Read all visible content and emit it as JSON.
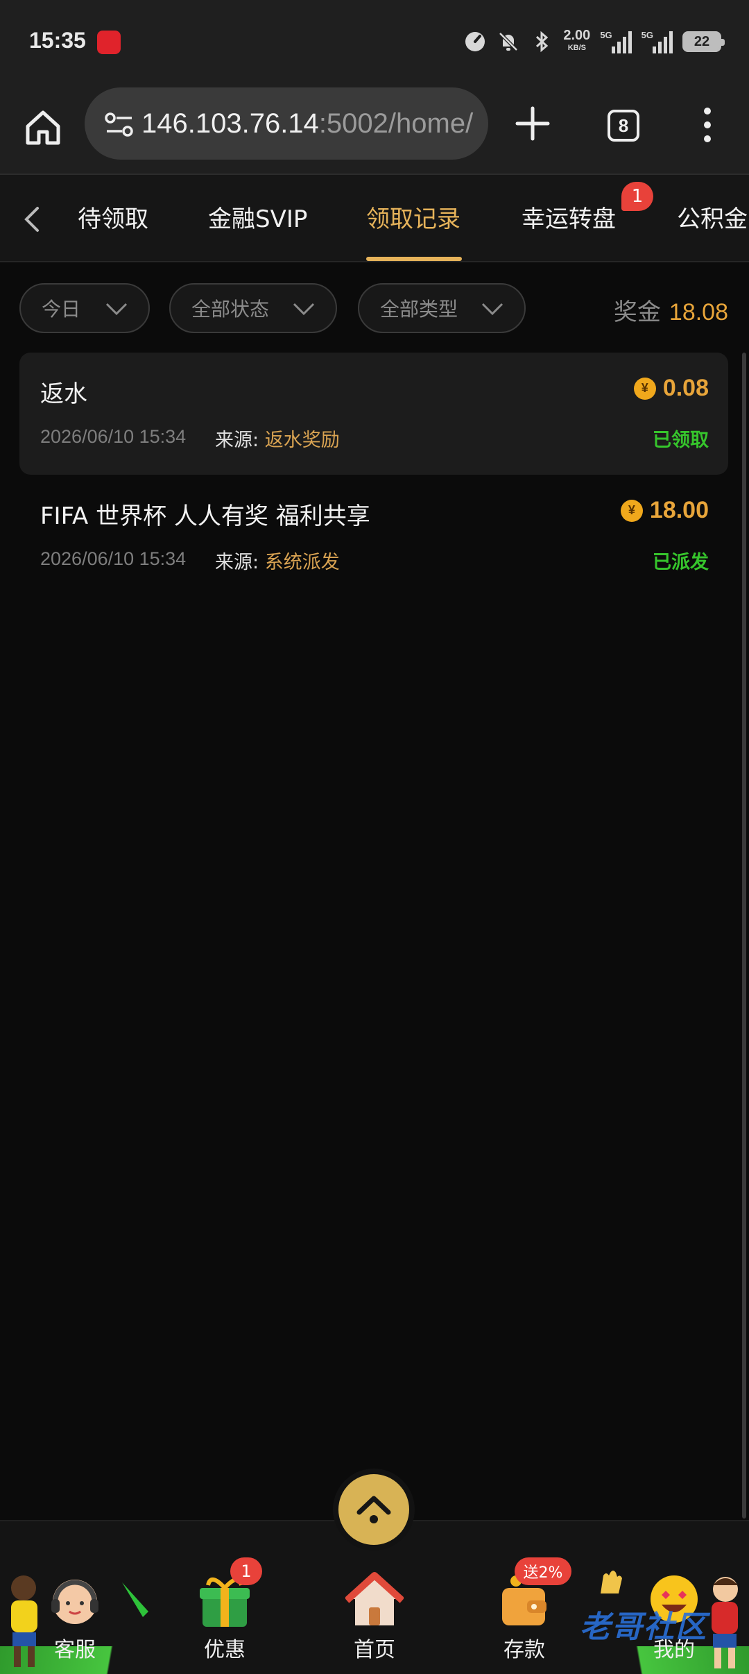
{
  "status_bar": {
    "time": "15:35",
    "speed_value": "2.00",
    "speed_unit": "KB/S",
    "net1": "5G",
    "net2": "5G",
    "battery": "22"
  },
  "browser": {
    "url_host": "146.103.76.14",
    "url_rest": ":5002/home/",
    "tab_count": "8"
  },
  "tabs": [
    {
      "label": "待领取"
    },
    {
      "label": "金融SVIP"
    },
    {
      "label": "领取记录"
    },
    {
      "label": "幸运转盘"
    },
    {
      "label": "公积金"
    }
  ],
  "tab_badge": "1",
  "filters": {
    "date": "今日",
    "status": "全部状态",
    "type": "全部类型",
    "bonus_label": "奖金",
    "bonus_value": "18.08"
  },
  "records": [
    {
      "title": "返水",
      "amount": "0.08",
      "time": "2026/06/10 15:34",
      "source_label": "来源:",
      "source": "返水奖励",
      "status": "已领取"
    },
    {
      "title": "FIFA 世界杯 人人有奖 福利共享",
      "amount": "18.00",
      "time": "2026/06/10 15:34",
      "source_label": "来源:",
      "source": "系统派发",
      "status": "已派发"
    }
  ],
  "bottom_nav": {
    "items": [
      {
        "label": "客服",
        "icon": "support-icon"
      },
      {
        "label": "优惠",
        "icon": "gift-icon",
        "badge": "1"
      },
      {
        "label": "首页",
        "icon": "home-icon"
      },
      {
        "label": "存款",
        "icon": "wallet-icon",
        "badge": "送2%"
      },
      {
        "label": "我的",
        "icon": "smiley-icon"
      }
    ],
    "watermark": "老哥社区"
  },
  "colors": {
    "accent_gold": "#e6b35a",
    "amount_orange": "#e8a53a",
    "status_green": "#36c52c",
    "badge_red": "#e8423a"
  }
}
